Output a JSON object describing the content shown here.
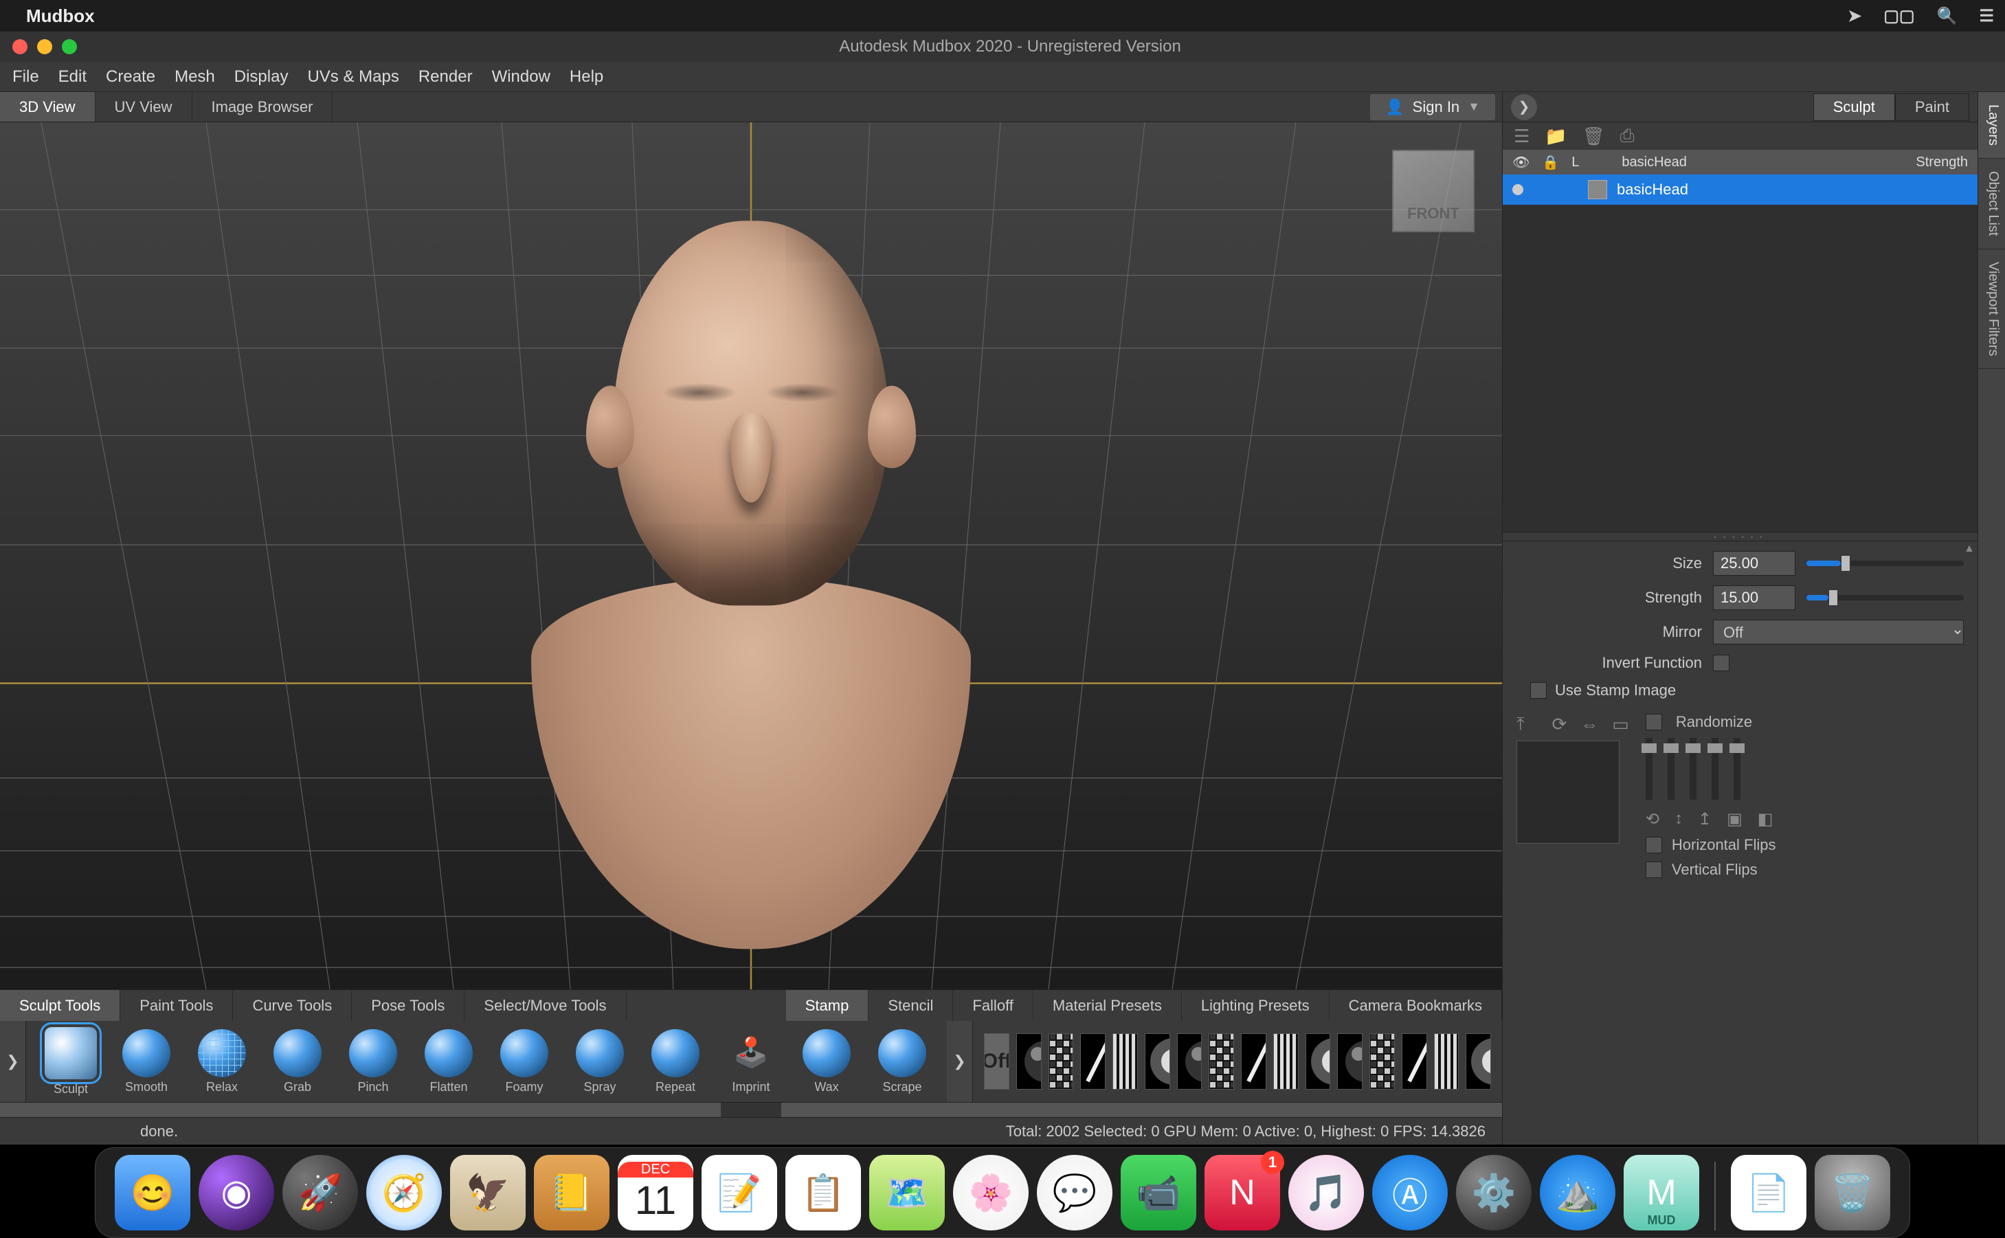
{
  "mac": {
    "appName": "Mudbox"
  },
  "window": {
    "title": "Autodesk Mudbox 2020 - Unregistered Version"
  },
  "menu": [
    "File",
    "Edit",
    "Create",
    "Mesh",
    "Display",
    "UVs & Maps",
    "Render",
    "Window",
    "Help"
  ],
  "viewTabs": [
    "3D View",
    "UV View",
    "Image Browser"
  ],
  "signIn": "Sign In",
  "viewcube": "FRONT",
  "sideTabs": [
    "Layers",
    "Object List",
    "Viewport Filters"
  ],
  "toolTabs": {
    "left": [
      "Sculpt Tools",
      "Paint Tools",
      "Curve Tools",
      "Pose Tools",
      "Select/Move Tools"
    ],
    "right": [
      "Stamp",
      "Stencil",
      "Falloff",
      "Material Presets",
      "Lighting Presets",
      "Camera Bookmarks"
    ]
  },
  "tools": [
    "Sculpt",
    "Smooth",
    "Relax",
    "Grab",
    "Pinch",
    "Flatten",
    "Foamy",
    "Spray",
    "Repeat",
    "Imprint",
    "Wax",
    "Scrape"
  ],
  "stampOff": "Off",
  "status": {
    "left": "done.",
    "right": "Total: 2002  Selected: 0 GPU Mem: 0  Active: 0, Highest: 0  FPS: 14.3826"
  },
  "right": {
    "tabs": [
      "Sculpt",
      "Paint"
    ],
    "listHdr": {
      "name": "basicHead",
      "strength": "Strength",
      "l": "L"
    },
    "row": {
      "name": "basicHead"
    },
    "props": {
      "sizeLabel": "Size",
      "sizeVal": "25.00",
      "strengthLabel": "Strength",
      "strengthVal": "15.00",
      "mirrorLabel": "Mirror",
      "mirrorVal": "Off",
      "invertLabel": "Invert Function",
      "useStampLabel": "Use Stamp Image",
      "randomize": "Randomize",
      "hflip": "Horizontal Flips",
      "vflip": "Vertical Flips"
    }
  },
  "dock": {
    "calMonth": "DEC",
    "calDay": "11",
    "newsBadge": "1",
    "mud": "MUD"
  }
}
